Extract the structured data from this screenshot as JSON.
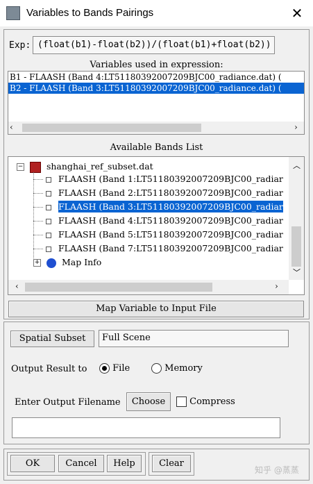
{
  "window": {
    "title": "Variables to Bands Pairings",
    "close_glyph": "✕"
  },
  "expression": {
    "label": "Exp:",
    "value": "(float(b1)-float(b2))/(float(b1)+float(b2))"
  },
  "variables": {
    "title": "Variables used in expression:",
    "items": [
      {
        "text": "B1 - FLAASH (Band 4:LT51180392007209BJC00_radiance.dat) (",
        "selected": false
      },
      {
        "text": "B2 - FLAASH (Band 3:LT51180392007209BJC00_radiance.dat) (",
        "selected": true
      }
    ]
  },
  "bands": {
    "title": "Available Bands List",
    "file": "shanghai_ref_subset.dat",
    "items": [
      {
        "text": "FLAASH (Band 1:LT51180392007209BJC00_radiar",
        "selected": false
      },
      {
        "text": "FLAASH (Band 2:LT51180392007209BJC00_radiar",
        "selected": false
      },
      {
        "text": "FLAASH (Band 3:LT51180392007209BJC00_radiar",
        "selected": true
      },
      {
        "text": "FLAASH (Band 4:LT51180392007209BJC00_radiar",
        "selected": false
      },
      {
        "text": "FLAASH (Band 5:LT51180392007209BJC00_radiar",
        "selected": false
      },
      {
        "text": "FLAASH (Band 7:LT51180392007209BJC00_radiar",
        "selected": false
      }
    ],
    "map_info": "Map Info"
  },
  "map_button": "Map Variable to Input File",
  "spatial_subset": {
    "button": "Spatial Subset",
    "value": "Full Scene"
  },
  "output": {
    "label": "Output Result to",
    "file": "File",
    "memory": "Memory",
    "selected": "File"
  },
  "filename": {
    "label": "Enter Output Filename",
    "choose": "Choose",
    "compress": "Compress"
  },
  "actions": {
    "ok": "OK",
    "cancel": "Cancel",
    "help": "Help",
    "clear": "Clear"
  },
  "watermark": "知乎 @蒸蒸",
  "colors": {
    "selection": "#0a64d2",
    "globe": "#1f4fd1",
    "file_icon": "#b02020"
  }
}
